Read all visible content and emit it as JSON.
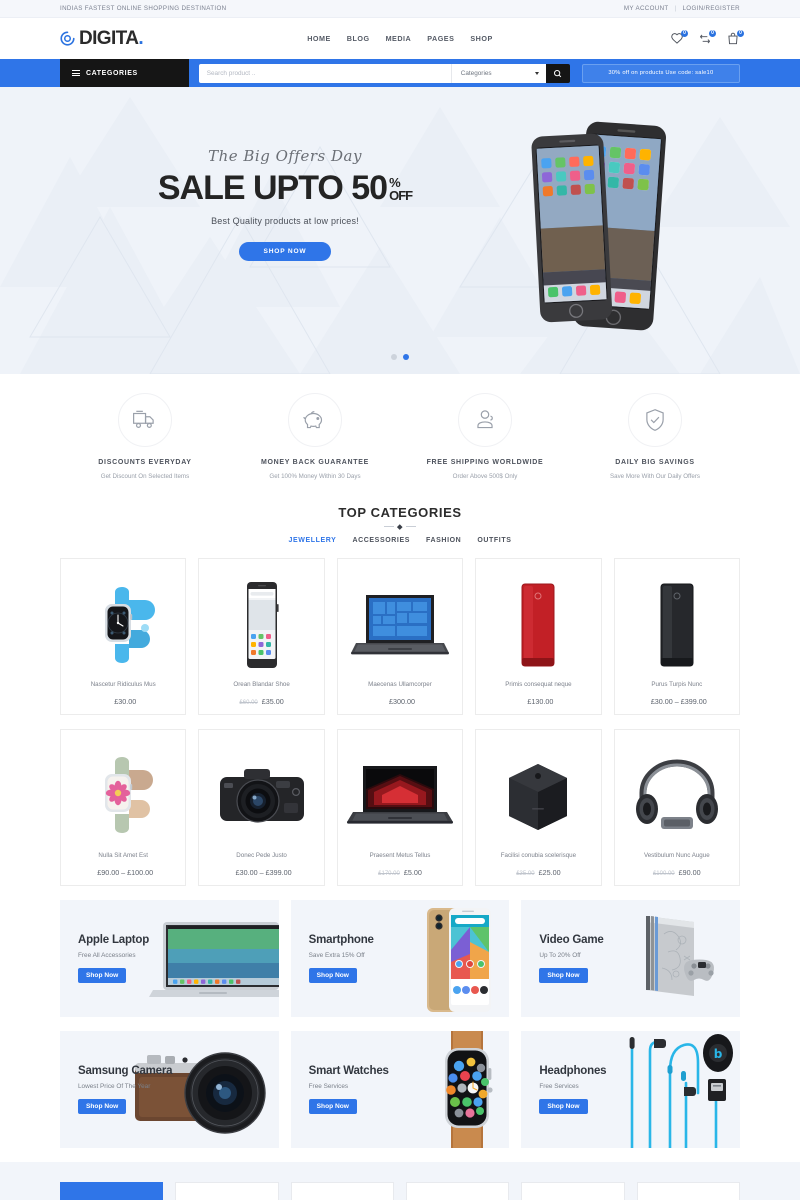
{
  "topbar": {
    "tagline": "INDIAS FASTEST ONLINE SHOPPING DESTINATION",
    "my_account": "MY ACCOUNT",
    "separator": "|",
    "login_register": "LOGIN/REGISTER"
  },
  "header": {
    "logo_text": "DIGITA",
    "logo_dot": ".",
    "nav": [
      {
        "label": "HOME"
      },
      {
        "label": "BLOG"
      },
      {
        "label": "MEDIA"
      },
      {
        "label": "PAGES"
      },
      {
        "label": "SHOP"
      }
    ],
    "icons": [
      {
        "name": "wishlist-icon",
        "count": "0"
      },
      {
        "name": "compare-icon",
        "count": "0"
      },
      {
        "name": "cart-icon",
        "count": "0"
      }
    ]
  },
  "searchbar": {
    "categories_button": "CATEGORIES",
    "search_placeholder": "Search product ..",
    "search_value": "",
    "category_select": "Categories",
    "promo_text": "30% off on products Use code: sale10"
  },
  "hero": {
    "script_line": "The Big Offers Day",
    "title": "SALE UPTO 50",
    "pct_symbol": "%",
    "pct_off": "OFF",
    "subtitle": "Best Quality products at low prices!",
    "button": "SHOP NOW",
    "slide_count": 2,
    "active_slide": 2
  },
  "features": [
    {
      "icon": "truck-icon",
      "title": "DISCOUNTS EVERYDAY",
      "subtitle": "Get Discount On Selected Items"
    },
    {
      "icon": "piggy-bank-icon",
      "title": "MONEY BACK GUARANTEE",
      "subtitle": "Get 100% Money Within 30 Days"
    },
    {
      "icon": "support-agent-icon",
      "title": "FREE SHIPPING WORLDWIDE",
      "subtitle": "Order Above 500$ Only"
    },
    {
      "icon": "shield-check-icon",
      "title": "DAILY BIG SAVINGS",
      "subtitle": "Save More With Our Daily Offers"
    }
  ],
  "categories_section": {
    "title": "TOP CATEGORIES",
    "tabs": [
      {
        "label": "JEWELLERY",
        "active": true
      },
      {
        "label": "ACCESSORIES",
        "active": false
      },
      {
        "label": "FASHION",
        "active": false
      },
      {
        "label": "OUTFITS",
        "active": false
      }
    ]
  },
  "products": [
    {
      "image": "smartwatch-blue-band",
      "name": "Nascetur Ridiculus Mus",
      "old_price": "",
      "price": "£30.00"
    },
    {
      "image": "android-phone-white",
      "name": "Orean Blandar Shoe",
      "old_price": "£60.00",
      "price": "£35.00"
    },
    {
      "image": "laptop-windows",
      "name": "Maecenas Ullamcorper",
      "old_price": "",
      "price": "£300.00"
    },
    {
      "image": "hard-drive-red",
      "name": "Primis consequat neque",
      "old_price": "",
      "price": "£130.00"
    },
    {
      "image": "hard-drive-black",
      "name": "Purus Turpis Nunc",
      "old_price": "",
      "price": "£30.00 – £399.00"
    },
    {
      "image": "smartwatch-floral",
      "name": "Nulla Sit Amet Est",
      "old_price": "",
      "price": "£90.00 – £100.00"
    },
    {
      "image": "dslr-camera",
      "name": "Donec Pede Justo",
      "old_price": "",
      "price": "£30.00 – £399.00"
    },
    {
      "image": "gaming-laptop-red",
      "name": "Praesent Metus Tellus",
      "old_price": "£170.00",
      "price": "£5.00"
    },
    {
      "image": "speaker-cube-black",
      "name": "Facilisi conubia scelerisque",
      "old_price": "£35.00",
      "price": "£25.00"
    },
    {
      "image": "headphones-silver",
      "name": "Vestibulum Nunc Augue",
      "old_price": "£100.00",
      "price": "£90.00"
    }
  ],
  "promos": [
    {
      "image": "macbook",
      "title": "Apple Laptop",
      "subtitle": "Free All Accessories",
      "button": "Shop Now"
    },
    {
      "image": "gold-smartphone",
      "title": "Smartphone",
      "subtitle": "Save Extra 15% Off",
      "button": "Shop Now"
    },
    {
      "image": "game-console",
      "title": "Video Game",
      "subtitle": "Up To 20% Off",
      "button": "Shop Now"
    },
    {
      "image": "samsung-camera",
      "title": "Samsung Camera",
      "subtitle": "Lowest Price Of The Year",
      "button": "Shop Now"
    },
    {
      "image": "apple-watch",
      "title": "Smart Watches",
      "subtitle": "Free Services",
      "button": "Shop Now"
    },
    {
      "image": "earphones-blue",
      "title": "Headphones",
      "subtitle": "Free Services",
      "button": "Shop Now"
    }
  ],
  "bottom_strip": {
    "tabs": [
      {
        "active": true
      },
      {
        "active": false
      },
      {
        "active": false
      },
      {
        "active": false
      },
      {
        "active": false
      },
      {
        "active": false
      }
    ]
  },
  "colors": {
    "accent": "#2f75e8",
    "dark": "#151515",
    "hero_bg": "#eff3f9",
    "promo_bg": "#f2f5fa"
  }
}
